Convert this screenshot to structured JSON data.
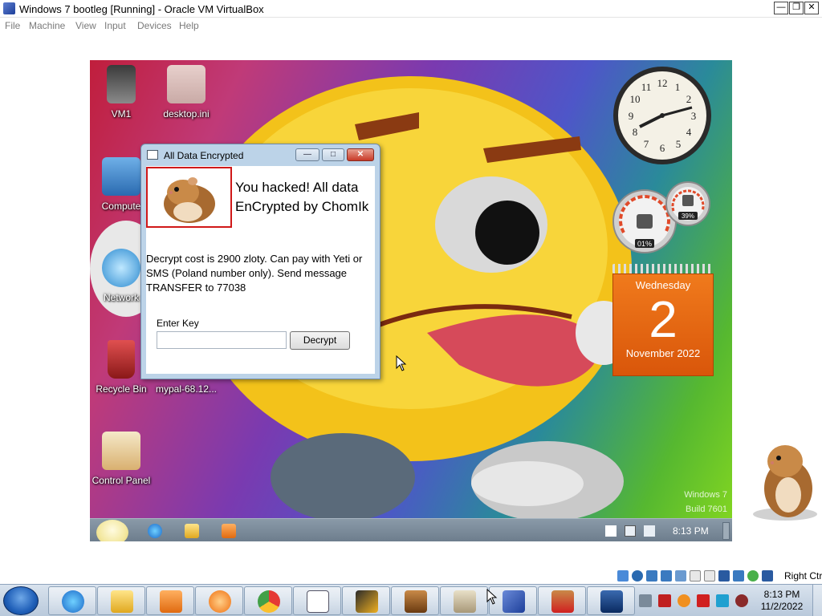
{
  "host_window": {
    "title": "Windows 7 bootleg [Running] - Oracle VM VirtualBox",
    "controls": {
      "minimize": "—",
      "restore": "❐",
      "close": "✕"
    },
    "menu": [
      "File",
      "Machine",
      "View",
      "Input",
      "Devices",
      "Help"
    ]
  },
  "guest": {
    "desktop_icons": [
      {
        "label": "VM1",
        "icon": "archive-icon"
      },
      {
        "label": "desktop.ini",
        "icon": "settings-file-icon"
      },
      {
        "label": "Compute",
        "icon": "computer-icon"
      },
      {
        "label": "Network",
        "icon": "network-icon"
      },
      {
        "label": "Recycle Bin",
        "icon": "recycle-bin-icon"
      },
      {
        "label": "mypal-68.12...",
        "icon": "mypal-icon"
      },
      {
        "label": "Control Panel",
        "icon": "control-panel-icon"
      }
    ],
    "watermark": {
      "line1": "Windows 7",
      "line2": "Build 7601"
    },
    "gadgets": {
      "clock": {
        "numbers": [
          "12",
          "1",
          "2",
          "3",
          "4",
          "5",
          "6",
          "7",
          "8",
          "9",
          "10",
          "11"
        ]
      },
      "cpu_gauge": {
        "value": "01%"
      },
      "memory_gauge": {
        "value": "39%"
      },
      "calendar": {
        "weekday": "Wednesday",
        "day": "2",
        "month_year": "November 2022"
      }
    },
    "taskbar": {
      "time": "8:13 PM",
      "pinned": [
        "ie-icon",
        "explorer-icon",
        "media-player-icon"
      ],
      "tray": [
        "flag-icon",
        "network-icon",
        "volume-icon"
      ]
    },
    "dialog": {
      "title": "All Data Encrypted",
      "controls": {
        "minimize": "—",
        "maximize": "□",
        "close": "✕"
      },
      "headline": "You hacked! All data EnCrypted by ChomIk",
      "message": "Decrypt cost is 2900 zloty. Can pay with Yeti or SMS (Poland number only). Send message TRANSFER to 77038",
      "key_label": "Enter Key",
      "key_value": "",
      "key_placeholder": "",
      "decrypt_button": "Decrypt"
    }
  },
  "vbox_status": {
    "indicators": [
      "hard-disk-icon",
      "optical-drive-icon",
      "audio-icon",
      "network-icon",
      "usb-icon",
      "shared-folders-icon",
      "display-icon",
      "recording-icon",
      "cpu-icon",
      "mouse-integration-icon",
      "arrow-icon"
    ],
    "host_key": "Right Ctrl"
  },
  "host_taskbar": {
    "apps": [
      "ie-icon",
      "explorer-icon",
      "media-player-icon",
      "uc-browser-icon",
      "chrome-icon",
      "window-app-icon",
      "winamp-icon",
      "hamster-box-icon",
      "sd-card-icon",
      "virtualbox-icon",
      "hamster-red-icon",
      "win7-64-icon"
    ],
    "time": "8:13 PM",
    "date": "11/2/2022",
    "tray": [
      "action-center-icon",
      "scissors-icon",
      "magnifier-icon",
      "red-flag-icon",
      "display-icon",
      "speaker-icon"
    ]
  }
}
